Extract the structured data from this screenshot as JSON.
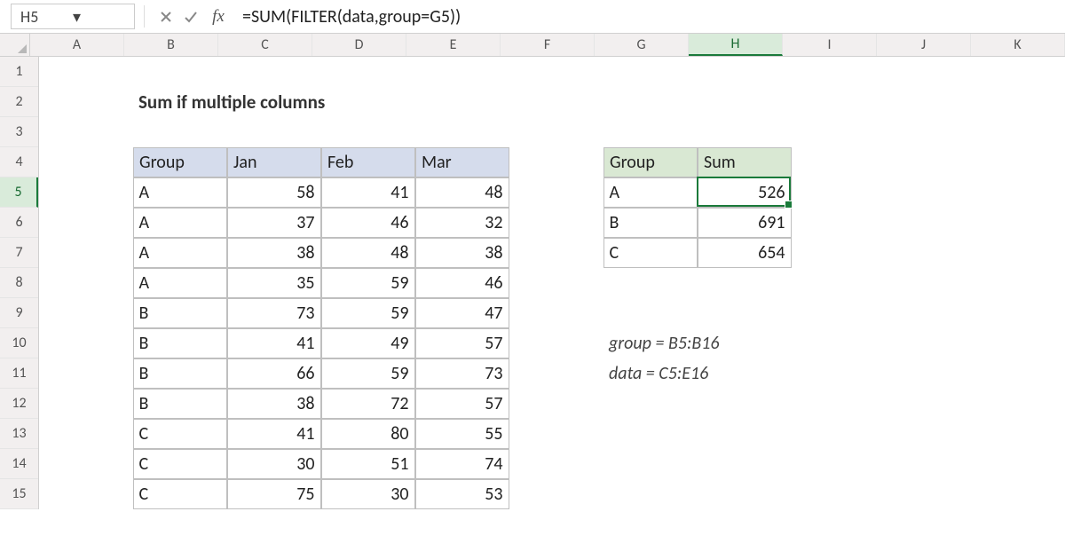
{
  "namebox": "H5",
  "formula": "=SUM(FILTER(data,group=G5))",
  "columns": [
    "A",
    "B",
    "C",
    "D",
    "E",
    "F",
    "G",
    "H",
    "I",
    "J",
    "K"
  ],
  "active_col_index": 7,
  "rows": [
    1,
    2,
    3,
    4,
    5,
    6,
    7,
    8,
    9,
    10,
    11,
    12,
    13,
    14,
    15
  ],
  "active_row_index": 4,
  "title": "Sum if multiple columns",
  "data_table": {
    "headers": [
      "Group",
      "Jan",
      "Feb",
      "Mar"
    ],
    "rows": [
      [
        "A",
        58,
        41,
        48
      ],
      [
        "A",
        37,
        46,
        32
      ],
      [
        "A",
        38,
        48,
        38
      ],
      [
        "A",
        35,
        59,
        46
      ],
      [
        "B",
        73,
        59,
        47
      ],
      [
        "B",
        41,
        49,
        57
      ],
      [
        "B",
        66,
        59,
        73
      ],
      [
        "B",
        38,
        72,
        57
      ],
      [
        "C",
        41,
        80,
        55
      ],
      [
        "C",
        30,
        51,
        74
      ],
      [
        "C",
        75,
        30,
        53
      ]
    ]
  },
  "summary_table": {
    "headers": [
      "Group",
      "Sum"
    ],
    "rows": [
      [
        "A",
        526
      ],
      [
        "B",
        691
      ],
      [
        "C",
        654
      ]
    ]
  },
  "notes": {
    "line1": "group = B5:B16",
    "line2": "data = C5:E16"
  },
  "chart_data": {
    "type": "table",
    "title": "Sum if multiple columns",
    "main": {
      "columns": [
        "Group",
        "Jan",
        "Feb",
        "Mar"
      ],
      "data": [
        [
          "A",
          58,
          41,
          48
        ],
        [
          "A",
          37,
          46,
          32
        ],
        [
          "A",
          38,
          48,
          38
        ],
        [
          "A",
          35,
          59,
          46
        ],
        [
          "B",
          73,
          59,
          47
        ],
        [
          "B",
          41,
          49,
          57
        ],
        [
          "B",
          66,
          59,
          73
        ],
        [
          "B",
          38,
          72,
          57
        ],
        [
          "C",
          41,
          80,
          55
        ],
        [
          "C",
          30,
          51,
          74
        ],
        [
          "C",
          75,
          30,
          53
        ]
      ]
    },
    "summary": {
      "columns": [
        "Group",
        "Sum"
      ],
      "data": [
        [
          "A",
          526
        ],
        [
          "B",
          691
        ],
        [
          "C",
          654
        ]
      ]
    },
    "named_ranges": {
      "group": "B5:B16",
      "data": "C5:E16"
    },
    "formula": "=SUM(FILTER(data,group=G5))"
  }
}
